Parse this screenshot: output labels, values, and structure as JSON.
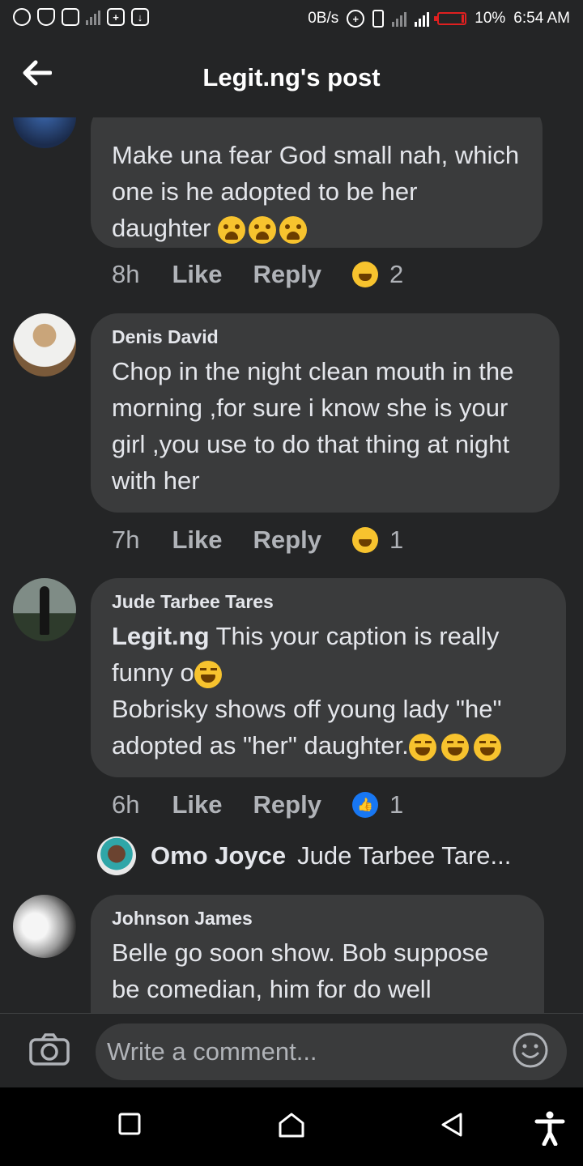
{
  "status_bar": {
    "speed": "0B/s",
    "battery": "10%",
    "time": "6:54 AM"
  },
  "header": {
    "title": "Legit.ng's post",
    "back_icon": "arrow-left-icon"
  },
  "comments": [
    {
      "author": "",
      "text": "Make una fear God small nah, which one is he adopted to be her daughter",
      "time": "8h",
      "like": "Like",
      "reply": "Reply",
      "reaction": "haha",
      "reaction_count": "2"
    },
    {
      "author": "Denis David",
      "text": "Chop in the night clean mouth in the morning ,for sure i know she is your girl ,you use to do that thing at night with her",
      "time": "7h",
      "like": "Like",
      "reply": "Reply",
      "reaction": "haha",
      "reaction_count": "1"
    },
    {
      "author": "Jude Tarbee Tares",
      "mention": "Legit.ng",
      "text_line1": " This your caption is really funny o",
      "text_line2": "Bobrisky  shows off young lady \"he\" adopted as \"her\" daughter.",
      "time": "6h",
      "like": "Like",
      "reply": "Reply",
      "reaction": "like",
      "reaction_count": "1"
    },
    {
      "author": "Johnson James",
      "text": "Belle go soon show. Bob suppose be comedian, him for do well"
    }
  ],
  "reply_preview": {
    "name": "Omo Joyce",
    "snippet": "Jude Tarbee Tare..."
  },
  "composer": {
    "placeholder": "Write a comment...",
    "camera_icon": "camera-icon",
    "emoji_icon": "smiley-icon"
  },
  "nav": {
    "icons": [
      "recents-square-icon",
      "home-icon",
      "back-triangle-icon",
      "accessibility-icon"
    ]
  },
  "colors": {
    "background": "#242526",
    "bubble": "#3a3b3c",
    "text": "#e4e6eb",
    "muted": "#b0b3b8",
    "like_blue": "#1877f2",
    "battery_red": "#e02020"
  }
}
